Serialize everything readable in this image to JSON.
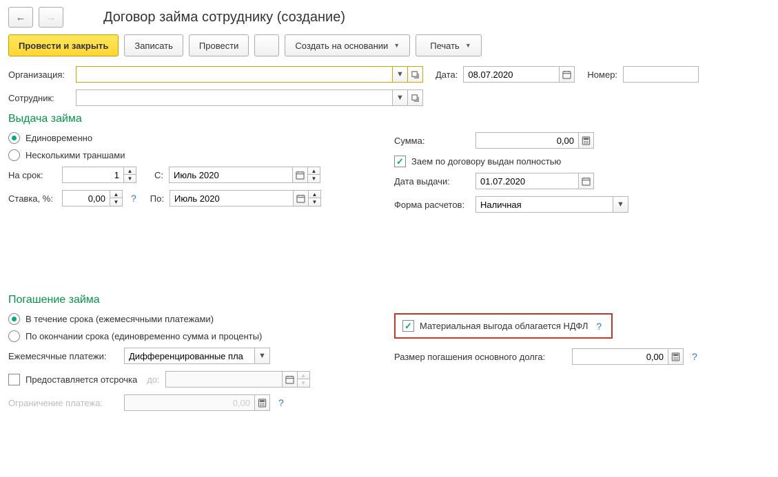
{
  "title": "Договор займа сотруднику (создание)",
  "toolbar": {
    "post_close": "Провести и закрыть",
    "save": "Записать",
    "post": "Провести",
    "create_based": "Создать на основании",
    "print": "Печать"
  },
  "header": {
    "org_label": "Организация:",
    "org_value": "",
    "date_label": "Дата:",
    "date_value": "08.07.2020",
    "number_label": "Номер:",
    "number_value": "",
    "employee_label": "Сотрудник:",
    "employee_value": ""
  },
  "issue": {
    "title": "Выдача займа",
    "radio_once": "Единовременно",
    "radio_tranches": "Несколькими траншами",
    "term_label": "На срок:",
    "term_value": "1",
    "from_label": "С:",
    "from_value": "Июль 2020",
    "rate_label": "Ставка, %:",
    "rate_value": "0,00",
    "to_label": "По:",
    "to_value": "Июль 2020",
    "sum_label": "Сумма:",
    "sum_value": "0,00",
    "full_check": "Заем по договору выдан полностью",
    "issue_date_label": "Дата выдачи:",
    "issue_date_value": "01.07.2020",
    "form_label": "Форма расчетов:",
    "form_value": "Наличная"
  },
  "repay": {
    "title": "Погашение займа",
    "radio_during": "В течение срока (ежемесячными платежами)",
    "radio_end": "По окончании срока (единовременно сумма и проценты)",
    "monthly_label": "Ежемесячные платежи:",
    "monthly_value": "Дифференцированные пла",
    "defer_check": "Предоставляется отсрочка",
    "defer_to": "до:",
    "defer_value": "",
    "limit_label": "Ограничение платежа:",
    "limit_value": "0,00",
    "ndfl_check": "Материальная выгода облагается НДФЛ",
    "principal_label": "Размер погашения основного долга:",
    "principal_value": "0,00"
  }
}
